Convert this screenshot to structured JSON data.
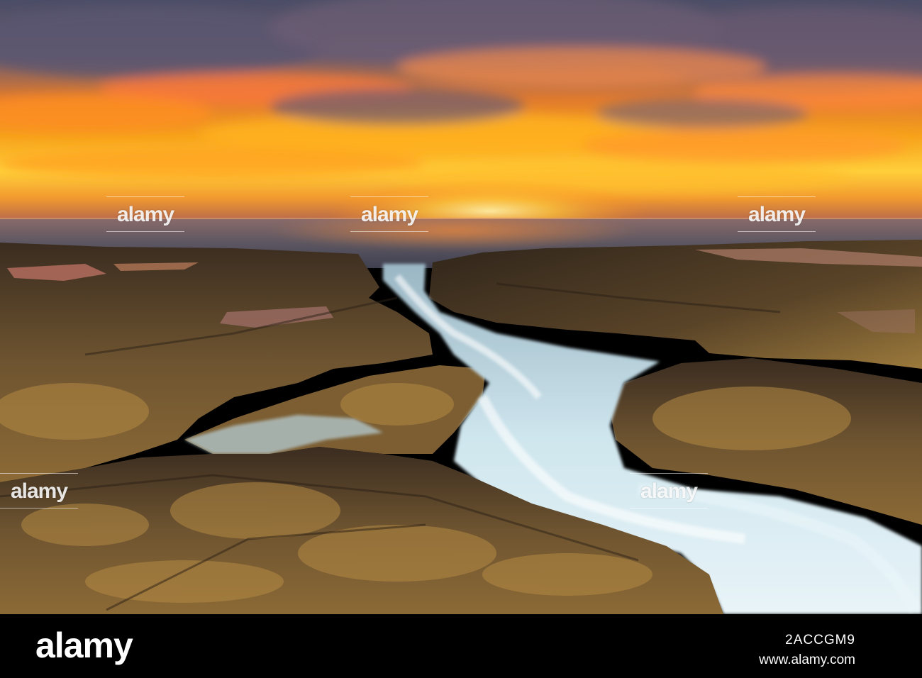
{
  "brand": {
    "logo_text": "alamy",
    "image_id": "2ACCGM9",
    "url": "www.alamy.com"
  },
  "watermark": {
    "text": "alamy",
    "color": "#ffffff"
  },
  "scene": {
    "colors": {
      "sky_top": "#4a4f66",
      "sky_glow": "#f7a21a",
      "horizon": "#ffcf3a",
      "sea": "#5c5661",
      "rock_dark": "#2e2419",
      "rock_lichen": "#9c7a3c",
      "water_foam": "#cfe6ee"
    }
  }
}
